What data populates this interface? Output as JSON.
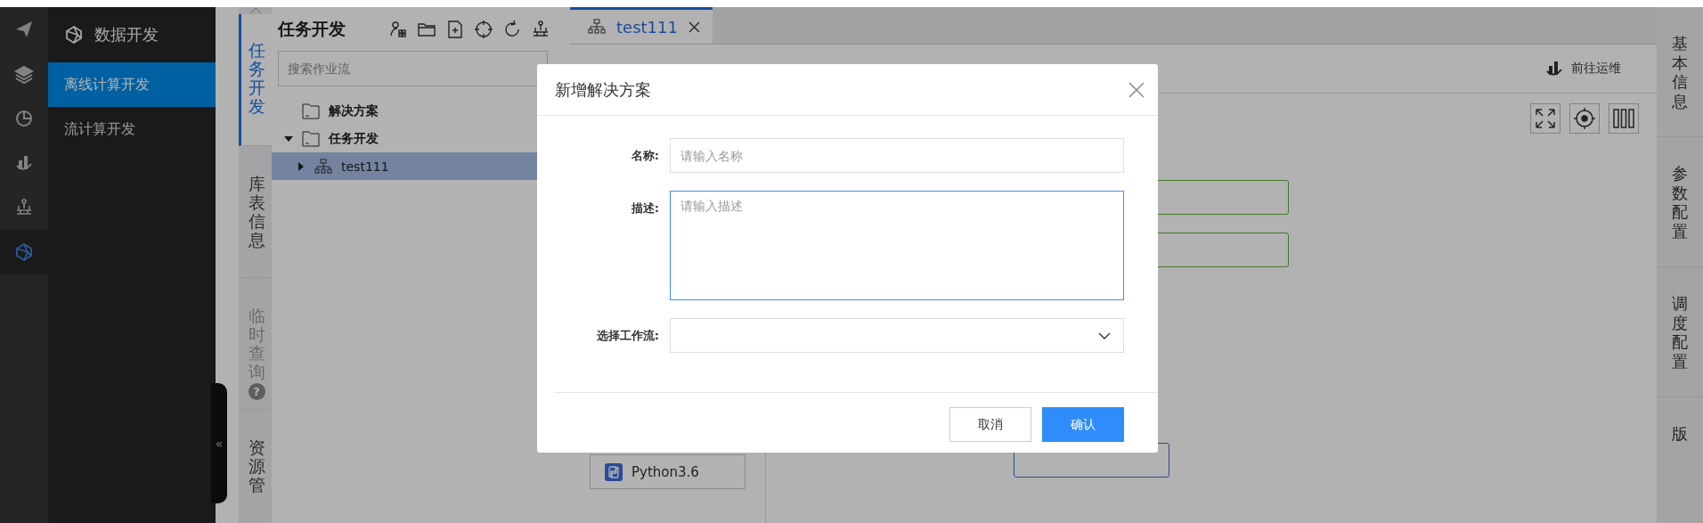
{
  "icon_rail": [
    {
      "kind": "send",
      "selected": false
    },
    {
      "kind": "layers",
      "selected": false
    },
    {
      "kind": "pie",
      "selected": false
    },
    {
      "kind": "ops",
      "selected": false
    },
    {
      "kind": "deploy",
      "selected": false
    },
    {
      "kind": "dev",
      "selected": true
    }
  ],
  "nav": {
    "title": "数据开发",
    "items": [
      {
        "label": "离线计算开发",
        "selected": true
      },
      {
        "label": "流计算开发",
        "selected": false
      }
    ],
    "collapse": "«"
  },
  "side_tabs": [
    {
      "label": "任务开发",
      "selected": true,
      "disabled": false
    },
    {
      "label": "库表信息",
      "selected": false,
      "disabled": false
    },
    {
      "label": "临时查询",
      "selected": false,
      "disabled": true,
      "help": "?"
    },
    {
      "label": "资源管",
      "selected": false,
      "disabled": false
    }
  ],
  "tree_panel": {
    "title": "任务开发",
    "search": {
      "placeholder": "搜索作业流"
    },
    "items": [
      {
        "label": "解决方案",
        "kind": "folder",
        "selected": false
      },
      {
        "label": "任务开发",
        "kind": "folder",
        "selected": false,
        "expanded": true,
        "children": [
          {
            "label": "test111",
            "kind": "flow",
            "selected": true,
            "expanded": false
          }
        ]
      }
    ]
  },
  "editor": {
    "tabs": [
      {
        "label": "test111",
        "selected": true
      }
    ],
    "ops_link": "前往运维",
    "palette": [
      {
        "label": "Python3.6"
      }
    ],
    "canvas_nodes": [
      {
        "kind": "shell"
      },
      {
        "kind": "shell"
      },
      {
        "kind": "python"
      }
    ]
  },
  "right_tabs": [
    {
      "label": "基本信息"
    },
    {
      "label": "参数配置"
    },
    {
      "label": "调度配置"
    },
    {
      "label": "版"
    }
  ],
  "modal": {
    "title": "新增解决方案",
    "fields": [
      {
        "kind": "input",
        "label": "名称:",
        "placeholder": "请输入名称",
        "focused": false
      },
      {
        "kind": "textarea",
        "label": "描述:",
        "placeholder": "请输入描述",
        "focused": true
      },
      {
        "kind": "select",
        "label": "选择工作流:",
        "focused": false
      }
    ],
    "buttons": [
      {
        "label": "取消",
        "kind": "default"
      },
      {
        "label": "确认",
        "kind": "primary"
      }
    ]
  }
}
